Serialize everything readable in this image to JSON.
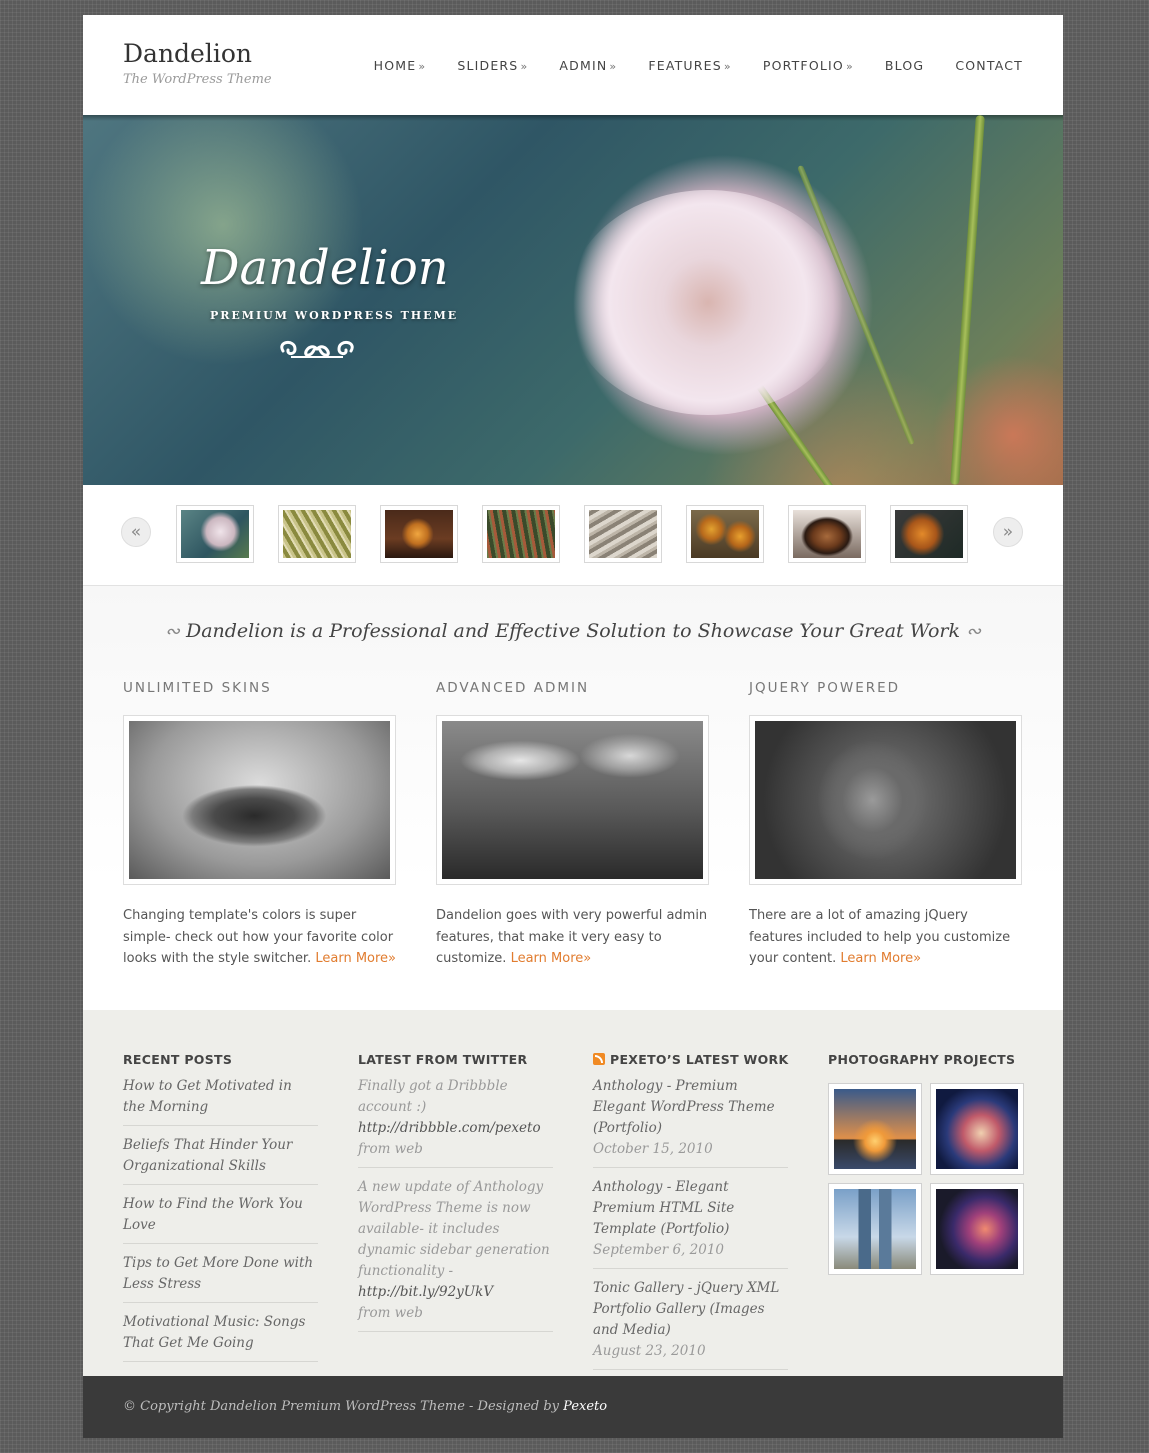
{
  "site": {
    "title": "Dandelion",
    "subtitle": "The WordPress Theme"
  },
  "nav": [
    {
      "label": "HOME",
      "arrow": "»"
    },
    {
      "label": "SLIDERS",
      "arrow": "»"
    },
    {
      "label": "ADMIN",
      "arrow": "»"
    },
    {
      "label": "FEATURES",
      "arrow": "»"
    },
    {
      "label": "PORTFOLIO",
      "arrow": "»"
    },
    {
      "label": "BLOG",
      "arrow": ""
    },
    {
      "label": "CONTACT",
      "arrow": ""
    }
  ],
  "hero": {
    "title": "Dandelion",
    "subtitle": "PREMIUM WORDPRESS THEME"
  },
  "thumbs": {
    "prev": "«",
    "next": "»",
    "count": 8
  },
  "intro": {
    "tagline": "Dandelion is a Professional and Effective Solution to Showcase Your Great Work",
    "columns": [
      {
        "title": "UNLIMITED SKINS",
        "text": "Changing template's colors is super simple- check out how your favorite color looks with the style switcher. ",
        "link": "Learn More»"
      },
      {
        "title": "ADVANCED ADMIN",
        "text": "Dandelion goes with very powerful admin features, that make it very easy to customize. ",
        "link": "Learn More»"
      },
      {
        "title": "JQUERY POWERED",
        "text": "There are a lot of amazing jQuery features included to help you customize your content. ",
        "link": "Learn More»"
      }
    ]
  },
  "widgets": {
    "recent": {
      "title": "RECENT POSTS",
      "items": [
        "How to Get Motivated in the Morning",
        "Beliefs That Hinder Your Organizational Skills",
        "How to Find the Work You Love",
        "Tips to Get More Done with Less Stress",
        "Motivational Music: Songs That Get Me Going"
      ]
    },
    "twitter": {
      "title": "LATEST FROM TWITTER",
      "tweets": [
        {
          "text": "Finally got a Dribbble account :)",
          "link": "http://dribbble.com/pexeto",
          "source": "from web"
        },
        {
          "text": "A new update of Anthology WordPress Theme is now available- it includes dynamic sidebar generation functionality -",
          "link": "http://bit.ly/92yUkV",
          "source": "from web"
        }
      ]
    },
    "work": {
      "title": "PEXETO’S LATEST WORK",
      "items": [
        {
          "title": "Anthology - Premium Elegant WordPress Theme (Portfolio)",
          "date": "October 15, 2010"
        },
        {
          "title": "Anthology - Elegant Premium HTML Site Template (Portfolio)",
          "date": "September 6, 2010"
        },
        {
          "title": "Tonic Gallery - jQuery XML Portfolio Gallery (Images and Media)",
          "date": "August 23, 2010"
        }
      ]
    },
    "photos": {
      "title": "PHOTOGRAPHY PROJECTS"
    }
  },
  "footer": {
    "text": "© Copyright Dandelion Premium WordPress Theme - Designed by ",
    "link": "Pexeto"
  },
  "colors": {
    "accent": "#e17c2f",
    "footer_bg": "#3a3a3a",
    "widgets_bg": "#eeeeea"
  }
}
